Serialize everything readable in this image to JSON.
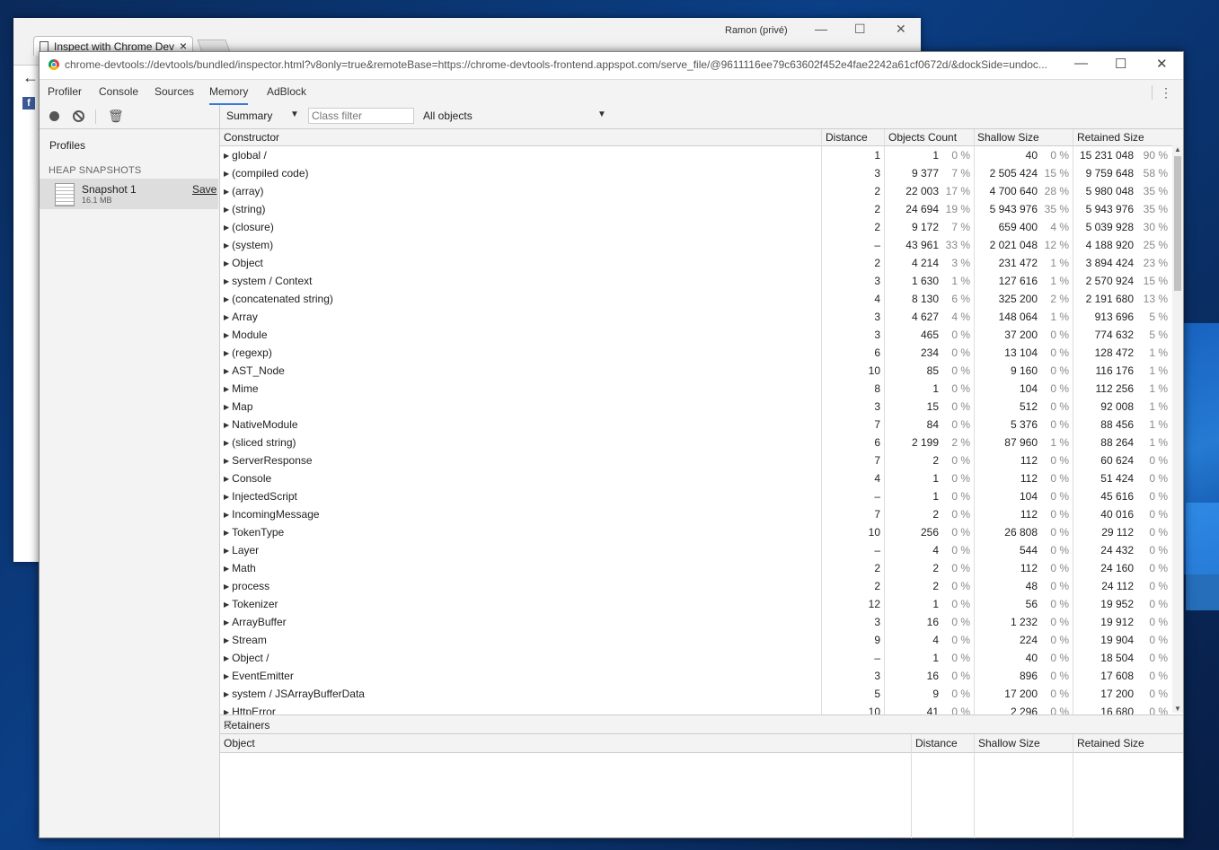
{
  "back_window": {
    "tab_title": "Inspect with Chrome Dev",
    "tab_close": "×",
    "user": "Ramon (privé)",
    "minimize": "—",
    "maximize": "☐",
    "close": "✕",
    "back_arrow": "←",
    "facebook_letter": "f"
  },
  "devtools_window": {
    "url": "chrome-devtools://devtools/bundled/inspector.html?v8only=true&remoteBase=https://chrome-devtools-frontend.appspot.com/serve_file/@9611116ee79c63602f452e4fae2242a61cf0672d/&dockSide=undoc...",
    "minimize": "—",
    "maximize": "☐",
    "close": "✕"
  },
  "tabs": [
    {
      "label": "Profiler"
    },
    {
      "label": "Console"
    },
    {
      "label": "Sources"
    },
    {
      "label": "Memory"
    },
    {
      "label": "AdBlock"
    }
  ],
  "selected_tab": "Memory",
  "sidebar": {
    "profiles_label": "Profiles",
    "heap_section": "HEAP SNAPSHOTS",
    "snapshot": {
      "name": "Snapshot 1",
      "size": "16.1 MB",
      "save": "Save"
    }
  },
  "toolbar": {
    "view": "Summary",
    "class_filter_placeholder": "Class filter",
    "objects": "All objects"
  },
  "columns": {
    "constructor": "Constructor",
    "distance": "Distance",
    "objects_count": "Objects Count",
    "shallow_size": "Shallow Size",
    "retained_size": "Retained Size"
  },
  "rows": [
    {
      "name": "global /",
      "distance": "1",
      "count": "1",
      "count_pct": "0 %",
      "shallow": "40",
      "shallow_pct": "0 %",
      "retained": "15 231 048",
      "retained_pct": "90 %"
    },
    {
      "name": "(compiled code)",
      "distance": "3",
      "count": "9 377",
      "count_pct": "7 %",
      "shallow": "2 505 424",
      "shallow_pct": "15 %",
      "retained": "9 759 648",
      "retained_pct": "58 %"
    },
    {
      "name": "(array)",
      "distance": "2",
      "count": "22 003",
      "count_pct": "17 %",
      "shallow": "4 700 640",
      "shallow_pct": "28 %",
      "retained": "5 980 048",
      "retained_pct": "35 %"
    },
    {
      "name": "(string)",
      "distance": "2",
      "count": "24 694",
      "count_pct": "19 %",
      "shallow": "5 943 976",
      "shallow_pct": "35 %",
      "retained": "5 943 976",
      "retained_pct": "35 %"
    },
    {
      "name": "(closure)",
      "distance": "2",
      "count": "9 172",
      "count_pct": "7 %",
      "shallow": "659 400",
      "shallow_pct": "4 %",
      "retained": "5 039 928",
      "retained_pct": "30 %"
    },
    {
      "name": "(system)",
      "distance": "–",
      "count": "43 961",
      "count_pct": "33 %",
      "shallow": "2 021 048",
      "shallow_pct": "12 %",
      "retained": "4 188 920",
      "retained_pct": "25 %"
    },
    {
      "name": "Object",
      "distance": "2",
      "count": "4 214",
      "count_pct": "3 %",
      "shallow": "231 472",
      "shallow_pct": "1 %",
      "retained": "3 894 424",
      "retained_pct": "23 %"
    },
    {
      "name": "system / Context",
      "distance": "3",
      "count": "1 630",
      "count_pct": "1 %",
      "shallow": "127 616",
      "shallow_pct": "1 %",
      "retained": "2 570 924",
      "retained_pct": "15 %"
    },
    {
      "name": "(concatenated string)",
      "distance": "4",
      "count": "8 130",
      "count_pct": "6 %",
      "shallow": "325 200",
      "shallow_pct": "2 %",
      "retained": "2 191 680",
      "retained_pct": "13 %"
    },
    {
      "name": "Array",
      "distance": "3",
      "count": "4 627",
      "count_pct": "4 %",
      "shallow": "148 064",
      "shallow_pct": "1 %",
      "retained": "913 696",
      "retained_pct": "5 %"
    },
    {
      "name": "Module",
      "distance": "3",
      "count": "465",
      "count_pct": "0 %",
      "shallow": "37 200",
      "shallow_pct": "0 %",
      "retained": "774 632",
      "retained_pct": "5 %"
    },
    {
      "name": "(regexp)",
      "distance": "6",
      "count": "234",
      "count_pct": "0 %",
      "shallow": "13 104",
      "shallow_pct": "0 %",
      "retained": "128 472",
      "retained_pct": "1 %"
    },
    {
      "name": "AST_Node",
      "distance": "10",
      "count": "85",
      "count_pct": "0 %",
      "shallow": "9 160",
      "shallow_pct": "0 %",
      "retained": "116 176",
      "retained_pct": "1 %"
    },
    {
      "name": "Mime",
      "distance": "8",
      "count": "1",
      "count_pct": "0 %",
      "shallow": "104",
      "shallow_pct": "0 %",
      "retained": "112 256",
      "retained_pct": "1 %"
    },
    {
      "name": "Map",
      "distance": "3",
      "count": "15",
      "count_pct": "0 %",
      "shallow": "512",
      "shallow_pct": "0 %",
      "retained": "92 008",
      "retained_pct": "1 %"
    },
    {
      "name": "NativeModule",
      "distance": "7",
      "count": "84",
      "count_pct": "0 %",
      "shallow": "5 376",
      "shallow_pct": "0 %",
      "retained": "88 456",
      "retained_pct": "1 %"
    },
    {
      "name": "(sliced string)",
      "distance": "6",
      "count": "2 199",
      "count_pct": "2 %",
      "shallow": "87 960",
      "shallow_pct": "1 %",
      "retained": "88 264",
      "retained_pct": "1 %"
    },
    {
      "name": "ServerResponse",
      "distance": "7",
      "count": "2",
      "count_pct": "0 %",
      "shallow": "112",
      "shallow_pct": "0 %",
      "retained": "60 624",
      "retained_pct": "0 %"
    },
    {
      "name": "Console",
      "distance": "4",
      "count": "1",
      "count_pct": "0 %",
      "shallow": "112",
      "shallow_pct": "0 %",
      "retained": "51 424",
      "retained_pct": "0 %"
    },
    {
      "name": "InjectedScript",
      "distance": "–",
      "count": "1",
      "count_pct": "0 %",
      "shallow": "104",
      "shallow_pct": "0 %",
      "retained": "45 616",
      "retained_pct": "0 %"
    },
    {
      "name": "IncomingMessage",
      "distance": "7",
      "count": "2",
      "count_pct": "0 %",
      "shallow": "112",
      "shallow_pct": "0 %",
      "retained": "40 016",
      "retained_pct": "0 %"
    },
    {
      "name": "TokenType",
      "distance": "10",
      "count": "256",
      "count_pct": "0 %",
      "shallow": "26 808",
      "shallow_pct": "0 %",
      "retained": "29 112",
      "retained_pct": "0 %"
    },
    {
      "name": "Layer",
      "distance": "–",
      "count": "4",
      "count_pct": "0 %",
      "shallow": "544",
      "shallow_pct": "0 %",
      "retained": "24 432",
      "retained_pct": "0 %"
    },
    {
      "name": "Math",
      "distance": "2",
      "count": "2",
      "count_pct": "0 %",
      "shallow": "112",
      "shallow_pct": "0 %",
      "retained": "24 160",
      "retained_pct": "0 %"
    },
    {
      "name": "process",
      "distance": "2",
      "count": "2",
      "count_pct": "0 %",
      "shallow": "48",
      "shallow_pct": "0 %",
      "retained": "24 112",
      "retained_pct": "0 %"
    },
    {
      "name": "Tokenizer",
      "distance": "12",
      "count": "1",
      "count_pct": "0 %",
      "shallow": "56",
      "shallow_pct": "0 %",
      "retained": "19 952",
      "retained_pct": "0 %"
    },
    {
      "name": "ArrayBuffer",
      "distance": "3",
      "count": "16",
      "count_pct": "0 %",
      "shallow": "1 232",
      "shallow_pct": "0 %",
      "retained": "19 912",
      "retained_pct": "0 %"
    },
    {
      "name": "Stream",
      "distance": "9",
      "count": "4",
      "count_pct": "0 %",
      "shallow": "224",
      "shallow_pct": "0 %",
      "retained": "19 904",
      "retained_pct": "0 %"
    },
    {
      "name": "Object /",
      "distance": "–",
      "count": "1",
      "count_pct": "0 %",
      "shallow": "40",
      "shallow_pct": "0 %",
      "retained": "18 504",
      "retained_pct": "0 %"
    },
    {
      "name": "EventEmitter",
      "distance": "3",
      "count": "16",
      "count_pct": "0 %",
      "shallow": "896",
      "shallow_pct": "0 %",
      "retained": "17 608",
      "retained_pct": "0 %"
    },
    {
      "name": "system / JSArrayBufferData",
      "distance": "5",
      "count": "9",
      "count_pct": "0 %",
      "shallow": "17 200",
      "shallow_pct": "0 %",
      "retained": "17 200",
      "retained_pct": "0 %"
    },
    {
      "name": "HttpError",
      "distance": "10",
      "count": "41",
      "count_pct": "0 %",
      "shallow": "2 296",
      "shallow_pct": "0 %",
      "retained": "16 680",
      "retained_pct": "0 %"
    }
  ],
  "retainers": {
    "title": "Retainers",
    "columns": {
      "object": "Object",
      "distance": "Distance",
      "shallow_size": "Shallow Size",
      "retained_size": "Retained Size"
    }
  },
  "icons": {
    "record": "record-icon",
    "clear": "clear-icon",
    "trash": "trash-icon",
    "expand": "▶",
    "dropdown": "▼",
    "kebab": "⋮"
  }
}
